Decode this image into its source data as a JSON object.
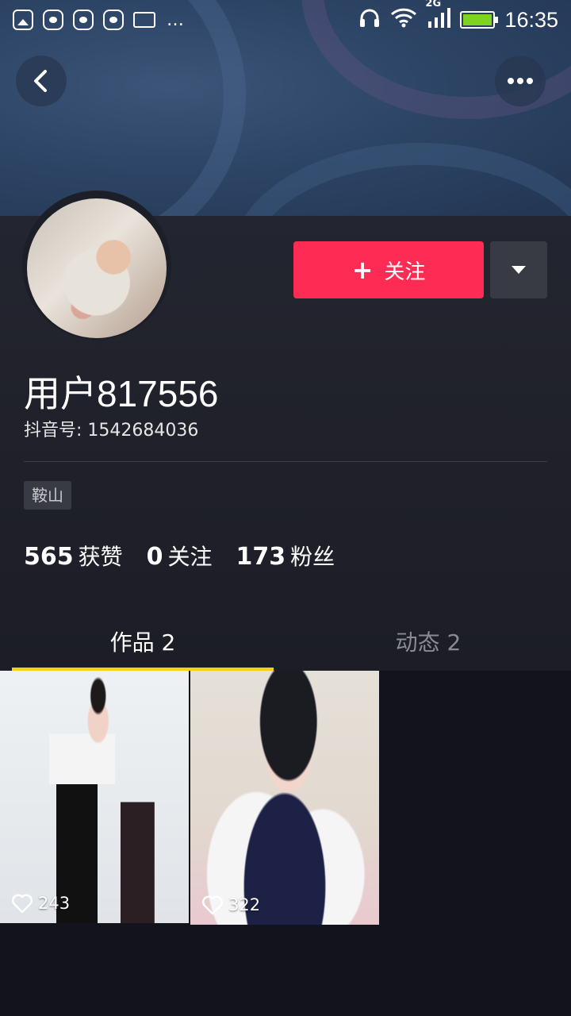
{
  "status_bar": {
    "network": "2G",
    "time": "16:35",
    "overflow": "…",
    "battery_color": "#7ed321",
    "left_icons": [
      "gallery-icon",
      "huawei-app-icon",
      "huawei-app-icon",
      "huawei-app-icon",
      "keyboard-icon"
    ],
    "right_icons": [
      "headphones-icon",
      "wifi-icon",
      "signal-icon",
      "battery-icon"
    ]
  },
  "nav": {
    "back_icon": "chevron-left-icon",
    "more_icon": "more-horizontal-icon"
  },
  "profile": {
    "username": "用户817556",
    "douyin_id": "抖音号: 1542684036",
    "follow_label": "关注",
    "follow_icon": "plus-icon",
    "dropdown_icon": "caret-down-icon",
    "location": "鞍山"
  },
  "stats": [
    {
      "num": "565",
      "label": "获赞"
    },
    {
      "num": "0",
      "label": "关注"
    },
    {
      "num": "173",
      "label": "粉丝"
    }
  ],
  "tabs": [
    {
      "label": "作品 2",
      "active": true
    },
    {
      "label": "动态 2",
      "active": false
    }
  ],
  "videos": [
    {
      "likes": "243"
    },
    {
      "likes": "322"
    }
  ],
  "colors": {
    "accent": "#fe2c55",
    "tab_indicator": "#face15",
    "background": "#161823"
  }
}
